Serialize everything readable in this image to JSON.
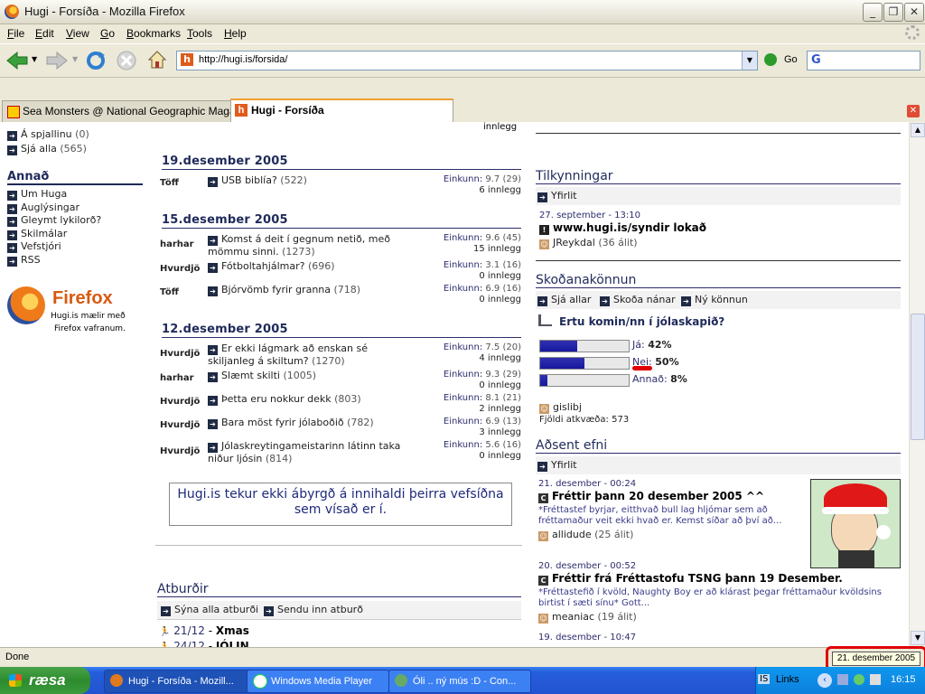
{
  "window": {
    "title": "Hugi - Forsíða - Mozilla Firefox"
  },
  "menu": [
    "File",
    "Edit",
    "View",
    "Go",
    "Bookmarks",
    "Tools",
    "Help"
  ],
  "address": {
    "url": "http://hugi.is/forsida/",
    "go_label": "Go",
    "search_logo": "G"
  },
  "tabs": [
    {
      "label": "Sea Monsters @ National Geographic Magaz..."
    },
    {
      "label": "Hugi - Forsíða"
    }
  ],
  "left": {
    "top_items": [
      {
        "label": "Á spjallinu",
        "count": "(0)"
      },
      {
        "label": "Sjá alla",
        "count": "(565)"
      }
    ],
    "annad_heading": "Annað",
    "annad_items": [
      "Um Huga",
      "Auglýsingar",
      "Gleymt lykilorð?",
      "Skilmálar",
      "Vefstjóri",
      "RSS"
    ],
    "firefox_word": "Firefox",
    "firefox_line1": "Hugi.is mælir með",
    "firefox_line2": "Firefox vafranum."
  },
  "middle": {
    "partial_top": "innlegg",
    "days": [
      {
        "date": "19.desember 2005",
        "entries": [
          {
            "tag": "Töff",
            "title": "USB biblía?",
            "count": "(522)",
            "score": "Einkunn:",
            "score_val": "9.7 (29)",
            "posts": "6 innlegg"
          }
        ]
      },
      {
        "date": "15.desember 2005",
        "entries": [
          {
            "tag": "harhar",
            "title": "Komst á deit í gegnum netið, með mömmu sinni.",
            "count": "(1273)",
            "score": "Einkunn:",
            "score_val": "9.6 (45)",
            "posts": "15 innlegg"
          },
          {
            "tag": "Hvurdjö",
            "title": "Fótboltahjálmar?",
            "count": "(696)",
            "score": "Einkunn:",
            "score_val": "3.1 (16)",
            "posts": "0 innlegg"
          },
          {
            "tag": "Töff",
            "title": "Bjórvömb fyrir granna",
            "count": "(718)",
            "score": "Einkunn:",
            "score_val": "6.9 (16)",
            "posts": "0 innlegg"
          }
        ]
      },
      {
        "date": "12.desember 2005",
        "entries": [
          {
            "tag": "Hvurdjö",
            "title": "Er ekki lágmark að enskan sé skiljanleg á skiltum?",
            "count": "(1270)",
            "score": "Einkunn:",
            "score_val": "7.5 (20)",
            "posts": "4 innlegg"
          },
          {
            "tag": "harhar",
            "title": "Slæmt skilti",
            "count": "(1005)",
            "score": "Einkunn:",
            "score_val": "9.3 (29)",
            "posts": "0 innlegg"
          },
          {
            "tag": "Hvurdjö",
            "title": "Þetta eru nokkur dekk",
            "count": "(803)",
            "score": "Einkunn:",
            "score_val": "8.1 (21)",
            "posts": "2 innlegg"
          },
          {
            "tag": "Hvurdjö",
            "title": "Bara möst fyrir jólaboðið",
            "count": "(782)",
            "score": "Einkunn:",
            "score_val": "6.9 (13)",
            "posts": "3 innlegg"
          },
          {
            "tag": "Hvurdjö",
            "title": "Jólaskreytingameistarinn látinn taka niður ljósin",
            "count": "(814)",
            "score": "Einkunn:",
            "score_val": "5.6 (16)",
            "posts": "0 innlegg"
          }
        ]
      }
    ],
    "disclaimer": "Hugi.is tekur ekki ábyrgð á innihaldi þeirra vefsíðna sem vísað er í.",
    "atburdir": {
      "heading": "Atburðir",
      "show_all": "Sýna alla atburði",
      "send": "Sendu inn atburð",
      "events": [
        {
          "date": "21/12",
          "name": "Xmas"
        },
        {
          "date": "24/12",
          "name": "JÓLIN"
        }
      ]
    }
  },
  "right": {
    "tilkynningar": {
      "heading": "Tilkynningar",
      "overview": "Yfirlit",
      "date": "27. september - 13:10",
      "title": "www.hugi.is/syndir lokað",
      "author": "JReykdal",
      "author_meta": "(36 álit)"
    },
    "poll": {
      "heading": "Skoðanakönnun",
      "see_all": "Sjá allar",
      "details": "Skoða nánar",
      "new_poll": "Ný könnun",
      "question": "Ertu komin/nn í jólaskapið?",
      "options": [
        {
          "label": "Já:",
          "pct": "42%",
          "value": 42
        },
        {
          "label": "Nei:",
          "pct": "50%",
          "value": 50
        },
        {
          "label": "Annað:",
          "pct": "8%",
          "value": 8
        }
      ],
      "author": "gislibj",
      "votes": "Fjöldi atkvæða: 573"
    },
    "adsent": {
      "heading": "Aðsent efni",
      "overview": "Yfirlit",
      "items": [
        {
          "date": "21. desember - 00:24",
          "title": "Fréttir þann 20 desember 2005 ^^",
          "excerpt": "*Fréttastef byrjar, eitthvað bull lag hljómar sem að fréttamaður veit ekki hvað er. Kemst síðar að því að...",
          "author": "allidude",
          "meta": "(25 álit)"
        },
        {
          "date": "20. desember - 00:52",
          "title": "Fréttir frá Fréttastofu TSNG þann 19 Desember.",
          "excerpt": "*Fréttastefið í kvöld, Naughty Boy er að klárast þegar fréttamaður kvöldsins birtist í sæti sínu* Gott...",
          "author": "meaniac",
          "meta": "(19 álit)"
        },
        {
          "date": "19. desember - 10:47",
          "title": ""
        }
      ]
    }
  },
  "status": {
    "text": "Done",
    "tooltip": "21. desember 2005"
  },
  "taskbar": {
    "start": "ræsa",
    "tasks": [
      "Hugi - Forsíða - Mozill...",
      "Windows Media Player",
      "Óli .. ný mús :D - Con..."
    ],
    "lang": "IS",
    "links": "Links",
    "clock": "16:15"
  }
}
